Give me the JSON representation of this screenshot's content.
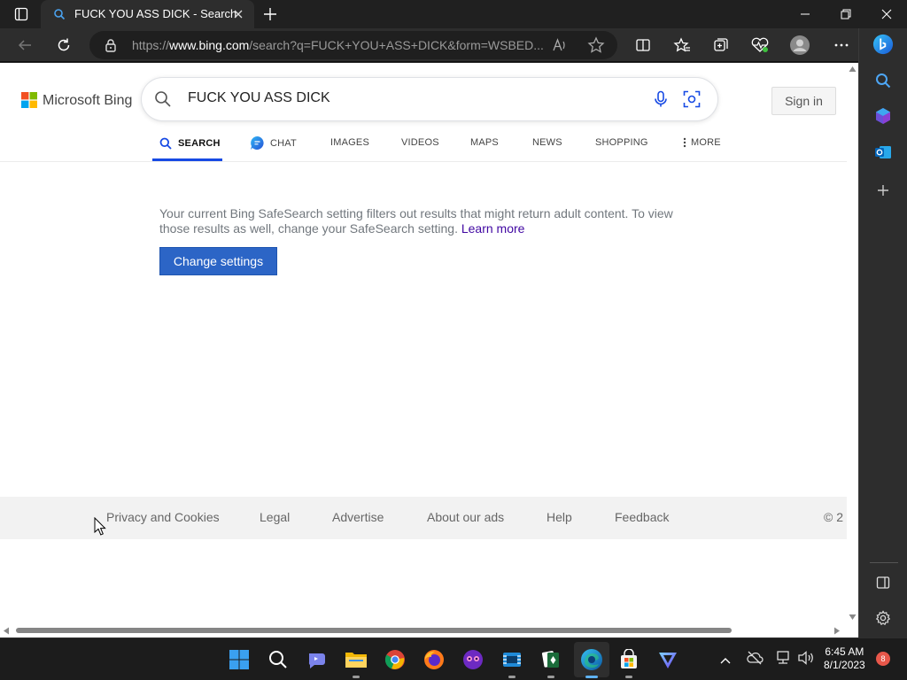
{
  "browser": {
    "tab_title": "FUCK YOU ASS DICK - Search",
    "url_prefix": "https://",
    "url_host": "www.bing.com",
    "url_rest": "/search?q=FUCK+YOU+ASS+DICK&form=WSBED..."
  },
  "bing": {
    "logo_text": "Microsoft Bing",
    "query": "FUCK YOU ASS DICK",
    "sign_in": "Sign in",
    "tabs": [
      "SEARCH",
      "CHAT",
      "IMAGES",
      "VIDEOS",
      "MAPS",
      "NEWS",
      "SHOPPING",
      "MORE"
    ],
    "active_tab": "SEARCH",
    "safesearch_message": "Your current Bing SafeSearch setting filters out results that might return adult content. To view those results as well, change your SafeSearch setting.",
    "learn_more": "Learn more",
    "change_settings": "Change settings",
    "footer": [
      "Privacy and Cookies",
      "Legal",
      "Advertise",
      "About our ads",
      "Help",
      "Feedback"
    ],
    "footer_copyright": "© 2"
  },
  "taskbar": {
    "time": "6:45 AM",
    "date": "8/1/2023",
    "notification_count": "8"
  },
  "colors": {
    "accent_blue": "#174ae4",
    "button_blue": "#2c65c6",
    "link_purple": "#4007a2"
  }
}
